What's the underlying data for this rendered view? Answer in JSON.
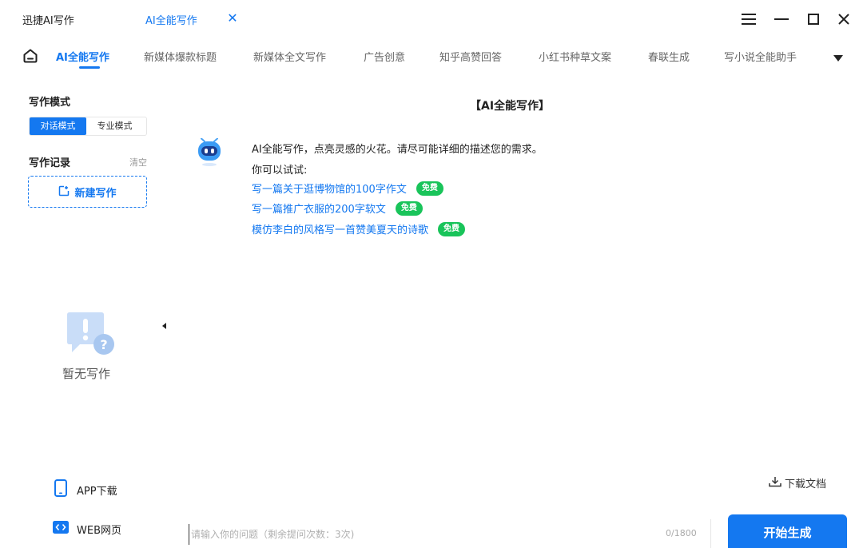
{
  "titlebar": {
    "app_name": "迅捷AI写作",
    "tab_title": "AI全能写作"
  },
  "nav": {
    "items": [
      {
        "label": "AI全能写作",
        "active": true
      },
      {
        "label": "新媒体爆款标题"
      },
      {
        "label": "新媒体全文写作"
      },
      {
        "label": "广告创意"
      },
      {
        "label": "知乎高赞回答"
      },
      {
        "label": "小红书种草文案"
      },
      {
        "label": "春联生成"
      },
      {
        "label": "写小说全能助手"
      }
    ]
  },
  "sidebar": {
    "mode_title": "写作模式",
    "modes": [
      {
        "label": "对话模式",
        "active": true
      },
      {
        "label": "专业模式"
      }
    ],
    "record_title": "写作记录",
    "clear_label": "清空",
    "new_label": "新建写作",
    "empty_text": "暂无写作",
    "app_download": "APP下载",
    "web_page": "WEB网页"
  },
  "main": {
    "heading": "【AI全能写作】",
    "intro": "AI全能写作，点亮灵感的火花。请尽可能详细的描述您的需求。",
    "try_text": "你可以试试:",
    "suggestions": [
      {
        "text": "写一篇关于逛博物馆的100字作文",
        "badge": "免费"
      },
      {
        "text": "写一篇推广衣服的200字软文",
        "badge": "免费"
      },
      {
        "text": "模仿李白的风格写一首赞美夏天的诗歌",
        "badge": "免费"
      }
    ]
  },
  "footer": {
    "download_doc": "下载文档",
    "input_placeholder": "请输入你的问题（剩余提问次数：3次)",
    "char_count": "0/1800",
    "generate_label": "开始生成"
  },
  "colors": {
    "accent": "#1478f0",
    "badge": "#19c45a"
  }
}
